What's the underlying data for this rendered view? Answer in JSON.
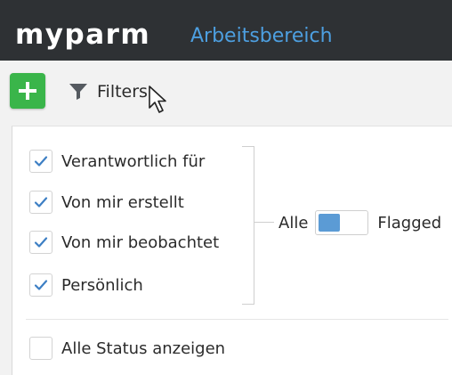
{
  "header": {
    "logo_text": "myparm",
    "workspace_label": "Arbeitsbereich",
    "workspace_color": "#4d9fe0"
  },
  "toolbar": {
    "add_button": {
      "icon": "plus-icon",
      "color": "#3ab54a"
    },
    "filters_label": "Filters",
    "filter_icon": "funnel-icon"
  },
  "filters": {
    "options": [
      {
        "label": "Verantwortlich für",
        "checked": true
      },
      {
        "label": "Von mir erstellt",
        "checked": true
      },
      {
        "label": "Von mir beobachtet",
        "checked": true
      },
      {
        "label": "Persönlich",
        "checked": true
      }
    ],
    "flag_toggle": {
      "left_label": "Alle",
      "right_label": "Flagged",
      "knob_color": "#5b9bd5"
    },
    "show_all_status": {
      "label": "Alle Status anzeigen",
      "checked": false
    }
  }
}
